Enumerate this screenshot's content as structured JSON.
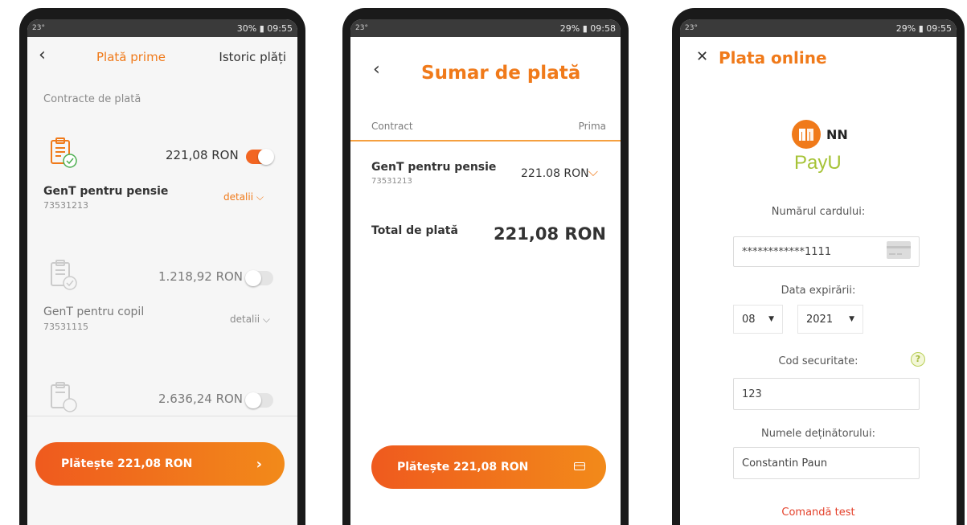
{
  "status": {
    "p1": {
      "left": "23°",
      "right": "30% ▮ 09:55"
    },
    "p2": {
      "left": "23°",
      "right": "29% ▮ 09:58"
    },
    "p3": {
      "left": "23°",
      "right": "29% ▮ 09:55"
    }
  },
  "screen1": {
    "title": "Plată prime",
    "history": "Istoric plăți",
    "section": "Contracte de plată",
    "contracts": [
      {
        "amount": "221,08 RON",
        "name": "GenT pentru pensie",
        "number": "73531213",
        "details": "detalii",
        "selected": true
      },
      {
        "amount": "1.218,92 RON",
        "name": "GenT pentru copil",
        "number": "73531115",
        "details": "detalii",
        "selected": false
      },
      {
        "amount": "2.636,24 RON",
        "selected": false
      }
    ],
    "pay_button": "Plătește 221,08 RON"
  },
  "screen2": {
    "title": "Sumar de plată",
    "col_contract": "Contract",
    "col_prima": "Prima",
    "item_name": "GenT pentru pensie",
    "item_number": "73531213",
    "item_amount": "221.08 RON",
    "total_label": "Total de plată",
    "total_amount": "221,08 RON",
    "pay_button": "Plătește 221,08 RON"
  },
  "screen3": {
    "title": "Plata online",
    "nn_text": "NN",
    "payu_text": "PayU",
    "card_label": "Numărul cardului:",
    "card_value": "************1111",
    "expiry_label": "Data expirării:",
    "month": "08",
    "year": "2021",
    "cvv_label": "Cod securitate:",
    "cvv_help": "?",
    "cvv_value": "123",
    "holder_label": "Numele deținătorului:",
    "holder_value": "Constantin Paun",
    "test_link": "Comandă test"
  },
  "colors": {
    "accent": "#f07a1a",
    "button_start": "#ef5a1e",
    "button_end": "#f28a1a",
    "test_link": "#e4412b"
  }
}
